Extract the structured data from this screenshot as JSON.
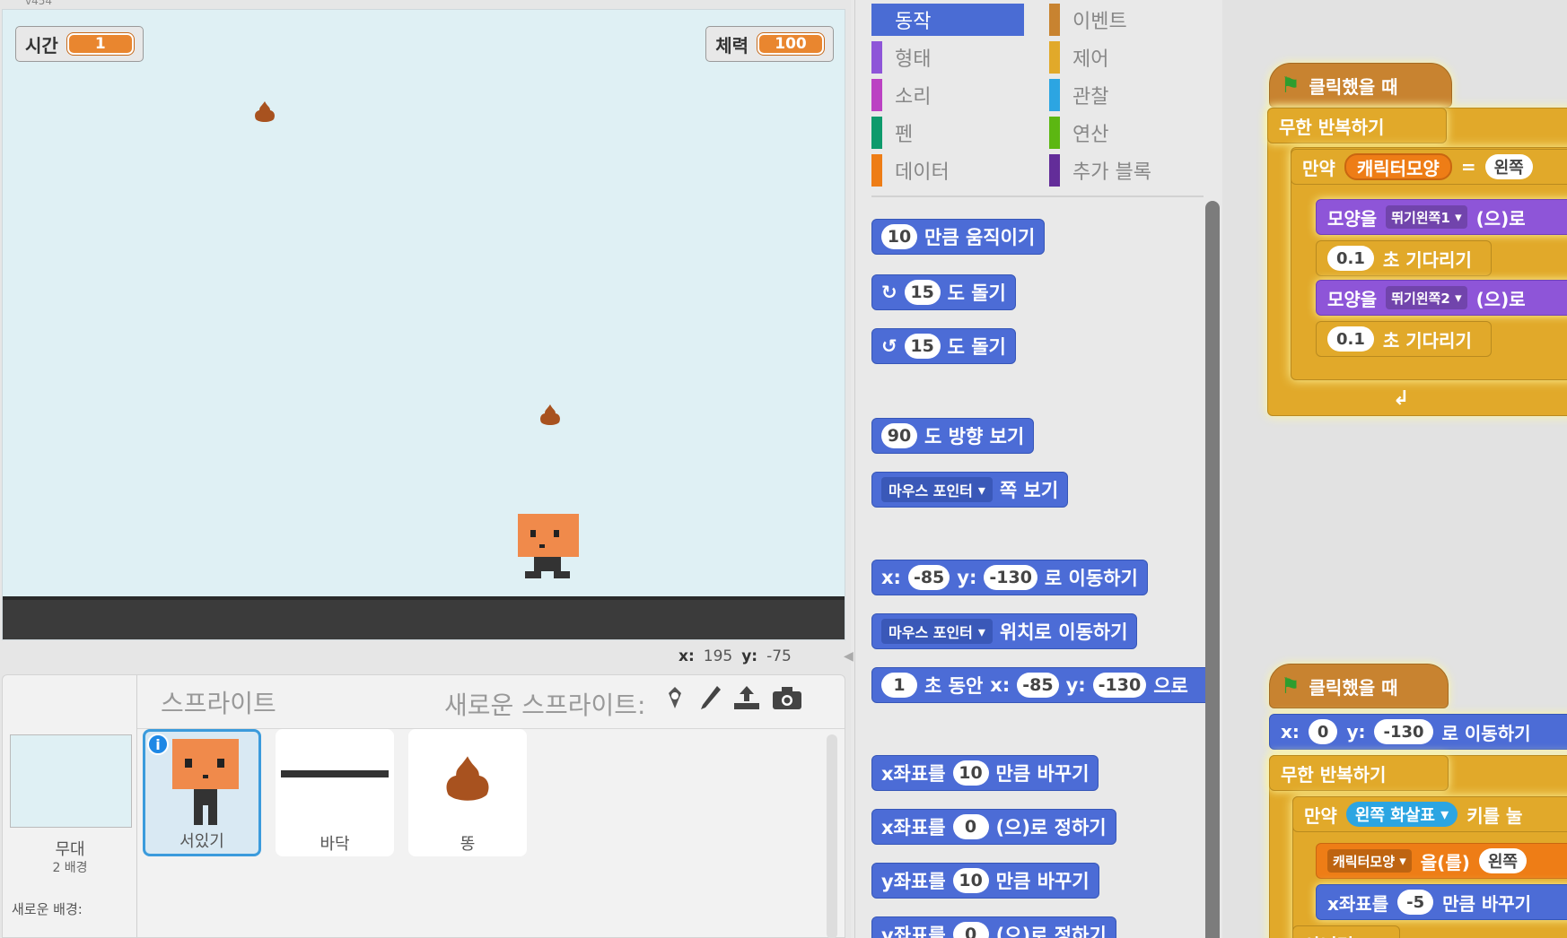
{
  "stage": {
    "version": "v454",
    "monitors": [
      {
        "label": "시간",
        "value": "1"
      },
      {
        "label": "체력",
        "value": "100"
      }
    ],
    "coords": {
      "x_label": "x:",
      "x": "195",
      "y_label": "y:",
      "y": "-75"
    }
  },
  "sprite_pane": {
    "title": "스프라이트",
    "new_sprite_label": "새로운 스프라이트:",
    "stage_label": "무대",
    "stage_sub": "2 배경",
    "new_bg_label": "새로운 배경:",
    "sprites": [
      {
        "name": "서있기",
        "selected": true
      },
      {
        "name": "바닥",
        "selected": false
      },
      {
        "name": "똥",
        "selected": false
      }
    ]
  },
  "palette": {
    "categories": [
      {
        "label": "동작",
        "color": "#4a6cd4",
        "active": true
      },
      {
        "label": "형태",
        "color": "#8e55d8"
      },
      {
        "label": "소리",
        "color": "#bb42c3"
      },
      {
        "label": "펜",
        "color": "#0e9a6c"
      },
      {
        "label": "데이터",
        "color": "#ee7d16"
      },
      {
        "label": "이벤트",
        "color": "#c88330"
      },
      {
        "label": "제어",
        "color": "#e1a92a"
      },
      {
        "label": "관찰",
        "color": "#2ca5e2"
      },
      {
        "label": "연산",
        "color": "#5cb712"
      },
      {
        "label": "추가 블록",
        "color": "#632d99"
      }
    ],
    "blocks": {
      "move": {
        "num": "10",
        "text": "만큼 움직이기"
      },
      "turn_cw": {
        "num": "15",
        "text": "도 돌기"
      },
      "turn_ccw": {
        "num": "15",
        "text": "도 돌기"
      },
      "point_dir": {
        "num": "90",
        "text": "도 방향 보기"
      },
      "point_towards": {
        "dd": "마우스 포인터",
        "text": "쪽 보기"
      },
      "goto_xy": {
        "x_label": "x:",
        "x": "-85",
        "y_label": "y:",
        "y": "-130",
        "text": "로 이동하기"
      },
      "goto_target": {
        "dd": "마우스 포인터",
        "text": "위치로 이동하기"
      },
      "glide": {
        "num": "1",
        "t1": "초 동안",
        "x_label": "x:",
        "x": "-85",
        "y_label": "y:",
        "y": "-130",
        "text": "으로"
      },
      "change_x": {
        "label": "x좌표를",
        "num": "10",
        "text": "만큼 바꾸기"
      },
      "set_x": {
        "label": "x좌표를",
        "num": "0",
        "text": "(으)로 정하기"
      },
      "change_y": {
        "label": "y좌표를",
        "num": "10",
        "text": "만큼 바꾸기"
      },
      "set_y": {
        "label": "y좌표를",
        "num": "0",
        "text": "(으)로 정하기"
      }
    }
  },
  "scripts": {
    "script1": {
      "hat": "클릭했을 때",
      "forever": "무한 반복하기",
      "if_label": "만약",
      "var": "캐릭터모양",
      "eq": "=",
      "cmp": "왼쪽",
      "switch1_label": "모양을",
      "switch1_dd": "뛰기왼쪽1",
      "switch1_tail": "(으)로",
      "wait1_num": "0.1",
      "wait1_text": "초 기다리기",
      "switch2_label": "모양을",
      "switch2_dd": "뛰기왼쪽2",
      "switch2_tail": "(으)로",
      "wait2_num": "0.1",
      "wait2_text": "초 기다리기"
    },
    "script2": {
      "hat": "클릭했을 때",
      "goto_x_label": "x:",
      "goto_x": "0",
      "goto_y_label": "y:",
      "goto_y": "-130",
      "goto_text": "로 이동하기",
      "forever": "무한 반복하기",
      "if_label": "만약",
      "key_dd": "왼쪽 화살표",
      "key_text": "키를 눌",
      "setvar_dd": "캐릭터모양",
      "setvar_text": "을(를)",
      "setvar_val": "왼쪽",
      "changex_label": "x좌표를",
      "changex_num": "-5",
      "changex_text": "만큼 바꾸기",
      "else_label": "아니면"
    }
  }
}
